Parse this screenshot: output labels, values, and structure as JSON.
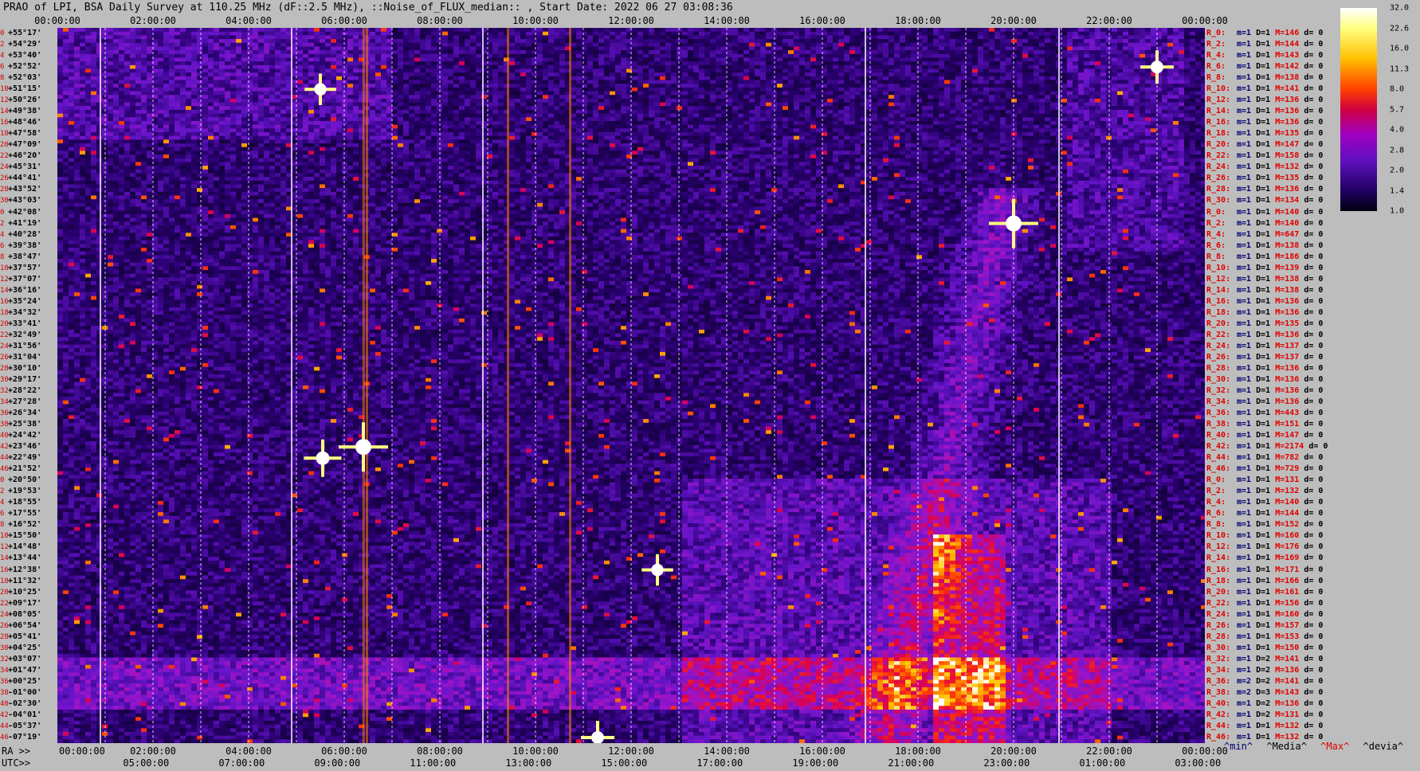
{
  "title": "PRAO of LPI, BSA Daily Survey at 110.25 MHz (dF::2.5 MHz), ::Noise_of_FLUX_median:: , Start Date: 2022 06 27 03:08:36",
  "chart_data": {
    "type": "heatmap",
    "title": "PRAO of LPI, BSA Daily Survey at 110.25 MHz (dF::2.5 MHz), ::Noise_of_FLUX_median:: , Start Date: 2022 06 27 03:08:36",
    "x_range_hours": [
      0,
      24
    ],
    "top_ticks": [
      "00:00:00",
      "02:00:00",
      "04:00:00",
      "06:00:00",
      "08:00:00",
      "10:00:00",
      "12:00:00",
      "14:00:00",
      "16:00:00",
      "18:00:00",
      "20:00:00",
      "22:00:00",
      "00:00:00"
    ],
    "ra_label": "RA >>",
    "ra_ticks": [
      "00:00:00",
      "02:00:00",
      "04:00:00",
      "06:00:00",
      "08:00:00",
      "10:00:00",
      "12:00:00",
      "14:00:00",
      "16:00:00",
      "18:00:00",
      "20:00:00",
      "22:00:00",
      "00:00:00"
    ],
    "utc_label": "UTC>>",
    "utc_ticks": [
      "05:00:00",
      "07:00:00",
      "09:00:00",
      "11:00:00",
      "13:00:00",
      "15:00:00",
      "17:00:00",
      "19:00:00",
      "21:00:00",
      "23:00:00",
      "01:00:00",
      "03:00:00"
    ],
    "utc_positions_hours": [
      1.855,
      3.855,
      5.855,
      7.855,
      9.855,
      11.855,
      13.855,
      15.855,
      17.855,
      19.855,
      21.855,
      23.855
    ],
    "declinations": [
      "+55°17'",
      "+54°29'",
      "+53°40'",
      "+52°52'",
      "+52°03'",
      "+51°15'",
      "+50°26'",
      "+49°38'",
      "+48°46'",
      "+47°58'",
      "+47°09'",
      "+46°20'",
      "+45°31'",
      "+44°41'",
      "+43°52'",
      "+43°03'",
      "+42°08'",
      "+41°19'",
      "+40°28'",
      "+39°38'",
      "+38°47'",
      "+37°57'",
      "+37°07'",
      "+36°16'",
      "+35°24'",
      "+34°32'",
      "+33°41'",
      "+32°49'",
      "+31°56'",
      "+31°04'",
      "+30°10'",
      "+29°17'",
      "+28°22'",
      "+27°28'",
      "+26°34'",
      "+25°38'",
      "+24°42'",
      "+23°46'",
      "+22°49'",
      "+21°52'",
      "+20°50'",
      "+19°53'",
      "+18°55'",
      "+17°55'",
      "+16°52'",
      "+15°50'",
      "+14°48'",
      "+13°44'",
      "+12°38'",
      "+11°32'",
      "+10°25'",
      "+09°17'",
      "+08°05'",
      "+06°54'",
      "+05°41'",
      "+04°25'",
      "+03°07'",
      "+01°47'",
      "+00°25'",
      "-01°00'",
      "-02°30'",
      "-04°01'",
      "-05°37'",
      "-07°19'"
    ],
    "row_indices": [
      "0",
      "2",
      "4",
      "6",
      "8",
      "10",
      "12",
      "14",
      "16",
      "18",
      "20",
      "22",
      "24",
      "26",
      "28",
      "30",
      "0",
      "2",
      "4",
      "6",
      "8",
      "10",
      "12",
      "14",
      "16",
      "18",
      "20",
      "22",
      "24",
      "26",
      "28",
      "30",
      "32",
      "34",
      "36",
      "38",
      "40",
      "42",
      "44",
      "46",
      "0",
      "2",
      "4",
      "6",
      "8",
      "10",
      "12",
      "14",
      "16",
      "18",
      "20",
      "22",
      "24",
      "26",
      "28",
      "30",
      "32",
      "34",
      "36",
      "38",
      "40",
      "42",
      "44",
      "46"
    ],
    "row_stats": [
      {
        "r": "R_0:",
        "m": 1,
        "D": 1,
        "M": 146,
        "d": 0
      },
      {
        "r": "R_2:",
        "m": 1,
        "D": 1,
        "M": 144,
        "d": 0
      },
      {
        "r": "R_4:",
        "m": 1,
        "D": 1,
        "M": 143,
        "d": 0
      },
      {
        "r": "R_6:",
        "m": 1,
        "D": 1,
        "M": 142,
        "d": 0
      },
      {
        "r": "R_8:",
        "m": 1,
        "D": 1,
        "M": 138,
        "d": 0
      },
      {
        "r": "R_10:",
        "m": 1,
        "D": 1,
        "M": 141,
        "d": 0
      },
      {
        "r": "R_12:",
        "m": 1,
        "D": 1,
        "M": 136,
        "d": 0
      },
      {
        "r": "R_14:",
        "m": 1,
        "D": 1,
        "M": 136,
        "d": 0
      },
      {
        "r": "R_16:",
        "m": 1,
        "D": 1,
        "M": 136,
        "d": 0
      },
      {
        "r": "R_18:",
        "m": 1,
        "D": 1,
        "M": 135,
        "d": 0
      },
      {
        "r": "R_20:",
        "m": 1,
        "D": 1,
        "M": 147,
        "d": 0
      },
      {
        "r": "R_22:",
        "m": 1,
        "D": 1,
        "M": 158,
        "d": 0
      },
      {
        "r": "R_24:",
        "m": 1,
        "D": 1,
        "M": 132,
        "d": 0
      },
      {
        "r": "R_26:",
        "m": 1,
        "D": 1,
        "M": 135,
        "d": 0
      },
      {
        "r": "R_28:",
        "m": 1,
        "D": 1,
        "M": 136,
        "d": 0
      },
      {
        "r": "R_30:",
        "m": 1,
        "D": 1,
        "M": 134,
        "d": 0
      },
      {
        "r": "R_0:",
        "m": 1,
        "D": 1,
        "M": 140,
        "d": 0
      },
      {
        "r": "R_2:",
        "m": 1,
        "D": 1,
        "M": 140,
        "d": 0
      },
      {
        "r": "R_4:",
        "m": 1,
        "D": 1,
        "M": 647,
        "d": 0
      },
      {
        "r": "R_6:",
        "m": 1,
        "D": 1,
        "M": 138,
        "d": 0
      },
      {
        "r": "R_8:",
        "m": 1,
        "D": 1,
        "M": 186,
        "d": 0
      },
      {
        "r": "R_10:",
        "m": 1,
        "D": 1,
        "M": 139,
        "d": 0
      },
      {
        "r": "R_12:",
        "m": 1,
        "D": 1,
        "M": 138,
        "d": 0
      },
      {
        "r": "R_14:",
        "m": 1,
        "D": 1,
        "M": 138,
        "d": 0
      },
      {
        "r": "R_16:",
        "m": 1,
        "D": 1,
        "M": 136,
        "d": 0
      },
      {
        "r": "R_18:",
        "m": 1,
        "D": 1,
        "M": 136,
        "d": 0
      },
      {
        "r": "R_20:",
        "m": 1,
        "D": 1,
        "M": 135,
        "d": 0
      },
      {
        "r": "R_22:",
        "m": 1,
        "D": 1,
        "M": 136,
        "d": 0
      },
      {
        "r": "R_24:",
        "m": 1,
        "D": 1,
        "M": 137,
        "d": 0
      },
      {
        "r": "R_26:",
        "m": 1,
        "D": 1,
        "M": 137,
        "d": 0
      },
      {
        "r": "R_28:",
        "m": 1,
        "D": 1,
        "M": 136,
        "d": 0
      },
      {
        "r": "R_30:",
        "m": 1,
        "D": 1,
        "M": 136,
        "d": 0
      },
      {
        "r": "R_32:",
        "m": 1,
        "D": 1,
        "M": 136,
        "d": 0
      },
      {
        "r": "R_34:",
        "m": 1,
        "D": 1,
        "M": 136,
        "d": 0
      },
      {
        "r": "R_36:",
        "m": 1,
        "D": 1,
        "M": 443,
        "d": 0
      },
      {
        "r": "R_38:",
        "m": 1,
        "D": 1,
        "M": 151,
        "d": 0
      },
      {
        "r": "R_40:",
        "m": 1,
        "D": 1,
        "M": 147,
        "d": 0
      },
      {
        "r": "R_42:",
        "m": 1,
        "D": 1,
        "M": 2174,
        "d": 0
      },
      {
        "r": "R_44:",
        "m": 1,
        "D": 1,
        "M": 782,
        "d": 0
      },
      {
        "r": "R_46:",
        "m": 1,
        "D": 1,
        "M": 729,
        "d": 0
      },
      {
        "r": "R_0:",
        "m": 1,
        "D": 1,
        "M": 131,
        "d": 0
      },
      {
        "r": "R_2:",
        "m": 1,
        "D": 1,
        "M": 132,
        "d": 0
      },
      {
        "r": "R_4:",
        "m": 1,
        "D": 1,
        "M": 140,
        "d": 0
      },
      {
        "r": "R_6:",
        "m": 1,
        "D": 1,
        "M": 144,
        "d": 0
      },
      {
        "r": "R_8:",
        "m": 1,
        "D": 1,
        "M": 152,
        "d": 0
      },
      {
        "r": "R_10:",
        "m": 1,
        "D": 1,
        "M": 160,
        "d": 0
      },
      {
        "r": "R_12:",
        "m": 1,
        "D": 1,
        "M": 176,
        "d": 0
      },
      {
        "r": "R_14:",
        "m": 1,
        "D": 1,
        "M": 169,
        "d": 0
      },
      {
        "r": "R_16:",
        "m": 1,
        "D": 1,
        "M": 171,
        "d": 0
      },
      {
        "r": "R_18:",
        "m": 1,
        "D": 1,
        "M": 166,
        "d": 0
      },
      {
        "r": "R_20:",
        "m": 1,
        "D": 1,
        "M": 161,
        "d": 0
      },
      {
        "r": "R_22:",
        "m": 1,
        "D": 1,
        "M": 156,
        "d": 0
      },
      {
        "r": "R_24:",
        "m": 1,
        "D": 1,
        "M": 160,
        "d": 0
      },
      {
        "r": "R_26:",
        "m": 1,
        "D": 1,
        "M": 157,
        "d": 0
      },
      {
        "r": "R_28:",
        "m": 1,
        "D": 1,
        "M": 153,
        "d": 0
      },
      {
        "r": "R_30:",
        "m": 1,
        "D": 1,
        "M": 150,
        "d": 0
      },
      {
        "r": "R_32:",
        "m": 1,
        "D": 2,
        "M": 141,
        "d": 0
      },
      {
        "r": "R_34:",
        "m": 1,
        "D": 2,
        "M": 136,
        "d": 0
      },
      {
        "r": "R_36:",
        "m": 2,
        "D": 2,
        "M": 141,
        "d": 0
      },
      {
        "r": "R_38:",
        "m": 2,
        "D": 3,
        "M": 143,
        "d": 0
      },
      {
        "r": "R_40:",
        "m": 1,
        "D": 2,
        "M": 136,
        "d": 0
      },
      {
        "r": "R_42:",
        "m": 1,
        "D": 2,
        "M": 131,
        "d": 0
      },
      {
        "r": "R_44:",
        "m": 1,
        "D": 1,
        "M": 132,
        "d": 0
      },
      {
        "r": "R_46:",
        "m": 1,
        "D": 1,
        "M": 132,
        "d": 0
      }
    ],
    "colorbar_ticks": [
      "32.0",
      "22.6",
      "16.0",
      "11.3",
      "8.0",
      "5.7",
      "4.0",
      "2.8",
      "2.0",
      "1.4",
      "1.0"
    ],
    "legend": [
      "^min^",
      "^Media^",
      "^Max^",
      "^devia^"
    ],
    "solid_lines_hours": [
      0.9,
      4.9,
      8.9,
      16.9,
      20.95
    ],
    "bright_sources": [
      {
        "x_hours": 6.4,
        "row": 37,
        "strength": 1.0
      },
      {
        "x_hours": 20.0,
        "row": 17,
        "strength": 1.0
      },
      {
        "x_hours": 5.55,
        "row": 38,
        "strength": 0.7
      },
      {
        "x_hours": 5.5,
        "row": 5,
        "strength": 0.55
      },
      {
        "x_hours": 23.0,
        "row": 3,
        "strength": 0.6
      },
      {
        "x_hours": 12.55,
        "row": 48,
        "strength": 0.55
      },
      {
        "x_hours": 11.3,
        "row": 63,
        "strength": 0.6
      }
    ],
    "colors": {
      "background": "#bdbdbd",
      "plot_bg": "#060018",
      "grid": "#ffffff",
      "row_label": "#d00000"
    }
  }
}
